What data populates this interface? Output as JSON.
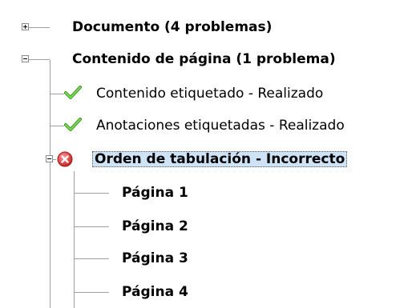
{
  "tree": {
    "items": [
      {
        "label": "Documento (4 problemas)"
      },
      {
        "label": "Contenido de página (1 problema)"
      },
      {
        "label": "Contenido etiquetado - Realizado"
      },
      {
        "label": "Anotaciones etiquetadas - Realizado"
      },
      {
        "label": "Orden de tabulación - Incorrecto"
      },
      {
        "label": "Página 1"
      },
      {
        "label": "Página 2"
      },
      {
        "label": "Página 3"
      },
      {
        "label": "Página 4"
      }
    ]
  },
  "icons": {
    "pass": "check-icon",
    "fail": "error-x-icon",
    "collapsed": "plus-expander-icon",
    "expanded": "minus-expander-icon"
  },
  "colors": {
    "selection_bg": "#cfe3f7",
    "pass_green": "#5cc23a",
    "fail_red": "#e34a4a",
    "tree_line": "#a0a0a0"
  }
}
